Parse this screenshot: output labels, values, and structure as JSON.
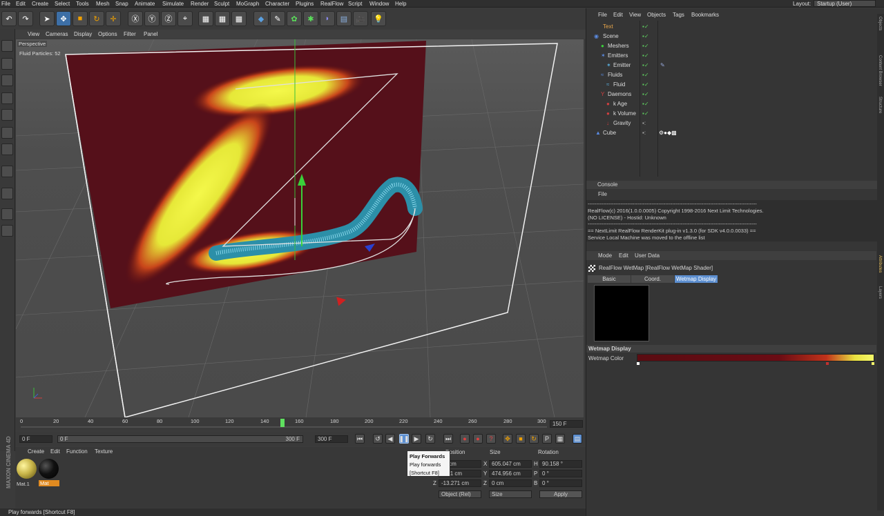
{
  "menubar": {
    "items": [
      "File",
      "Edit",
      "Create",
      "Select",
      "Tools",
      "Mesh",
      "Snap",
      "Animate",
      "Simulate",
      "Render",
      "Sculpt",
      "MoGraph",
      "Character",
      "Plugins",
      "RealFlow",
      "Script",
      "Window",
      "Help"
    ],
    "layout_label": "Layout:",
    "layout_value": "Startup (User)"
  },
  "viewport": {
    "menu": [
      "View",
      "Cameras",
      "Display",
      "Options",
      "Filter",
      "Panel"
    ],
    "camera_label": "Perspective",
    "info_text": "Fluid  Particles: 52"
  },
  "timeline": {
    "ticks": [
      "0",
      "20",
      "40",
      "60",
      "80",
      "100",
      "120",
      "140",
      "160",
      "180",
      "200",
      "220",
      "240",
      "260",
      "280",
      "300"
    ],
    "current_frame": "150 F"
  },
  "transport": {
    "start_field": "0 F",
    "slider_start": "0 F",
    "slider_end": "300 F",
    "end_field": "300 F"
  },
  "materials": {
    "menu": [
      "Create",
      "Edit",
      "Function",
      "Texture"
    ],
    "items": [
      {
        "label": "Mat.1",
        "color": "#c9b64a"
      },
      {
        "label": "Mat",
        "color": "#111111"
      }
    ],
    "brand": "MAXON CINEMA 4D"
  },
  "coords": {
    "headers": [
      "Position",
      "Size",
      "Rotation"
    ],
    "rows": [
      {
        "axis": "X",
        "pos": "14 cm",
        "size_axis": "X",
        "size": "605.047 cm",
        "rot_axis": "H",
        "rot": "90.158 °"
      },
      {
        "axis": "Y",
        "pos": "1211 cm",
        "size_axis": "Y",
        "size": "474.956 cm",
        "rot_axis": "P",
        "rot": "0 °"
      },
      {
        "axis": "Z",
        "pos": "-13.271 cm",
        "size_axis": "Z",
        "size": "0 cm",
        "rot_axis": "B",
        "rot": "0 °"
      }
    ],
    "mode_select": "Object (Rel)",
    "size_select": "Size",
    "apply_label": "Apply"
  },
  "tooltip": {
    "title": "Play Forwards",
    "line1": "Play forwards",
    "line2": "[Shortcut F8]"
  },
  "status": "Play forwards [Shortcut F8]",
  "object_manager": {
    "menu": [
      "File",
      "Edit",
      "View",
      "Objects",
      "Tags",
      "Bookmarks"
    ],
    "objects": [
      {
        "name": "Text",
        "color": "#e8a64a"
      },
      {
        "name": "Scene",
        "color": "#dddddd"
      },
      {
        "name": "Meshers",
        "color": "#dddddd"
      },
      {
        "name": "Emitters",
        "color": "#dddddd"
      },
      {
        "name": "Emitter",
        "color": "#dddddd"
      },
      {
        "name": "Fluids",
        "color": "#dddddd"
      },
      {
        "name": "Fluid",
        "color": "#dddddd"
      },
      {
        "name": "Daemons",
        "color": "#dddddd"
      },
      {
        "name": "k Age",
        "color": "#dddddd"
      },
      {
        "name": "k Volume",
        "color": "#dddddd"
      },
      {
        "name": "Gravity",
        "color": "#dddddd"
      },
      {
        "name": "Cube",
        "color": "#dddddd"
      }
    ]
  },
  "console": {
    "title": "Console",
    "menu": "File",
    "lines": [
      "--------------------------------------------------------------------------------------------------",
      "RealFlow(c) 2016(1.0.0.0005) Copyright 1998-2016 Next Limit Technologies.",
      "(NO LICENSE) - Hostid: Unknown",
      "--------------------------------------------------------------------------------------------------",
      "== NextLimit RealFlow RenderKit plug-in v1.3.0 (for SDK v4.0.0.0033) ==",
      "Service Local Machine was moved to the offline list"
    ]
  },
  "attributes": {
    "menu": [
      "Mode",
      "Edit",
      "User Data"
    ],
    "title": "RealFlow WetMap [RealFlow WetMap Shader]",
    "tabs": [
      "Basic",
      "Coord.",
      "Wetmap Display"
    ],
    "section": "Wetmap Display",
    "param_label": "Wetmap Color"
  },
  "sidetabs": [
    "Objects",
    "Content Browser",
    "Structure",
    "Attributes",
    "Layers"
  ],
  "colors": {
    "accent": "#4f8ad8",
    "wetmap_red": "#5a0c12",
    "fluid_yellow": "#e8f03a",
    "particle_cyan": "#4ab6d8"
  }
}
